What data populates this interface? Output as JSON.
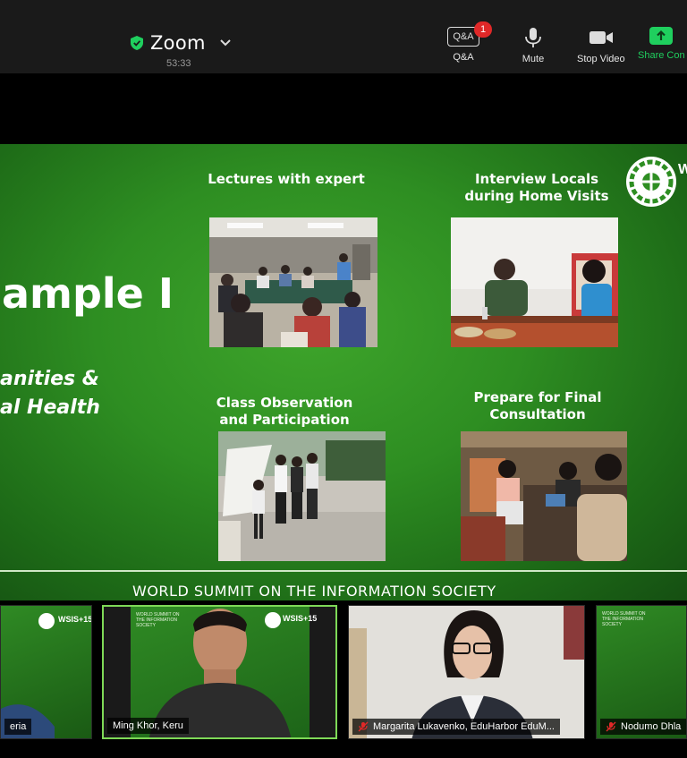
{
  "toolbar": {
    "app_name": "Zoom",
    "timer": "53:33",
    "qa_icon_text": "Q&A",
    "qa_badge": "1",
    "qa_label": "Q&A",
    "mute_label": "Mute",
    "stop_video_label": "Stop Video",
    "share_label": "Share Con"
  },
  "slide": {
    "title_fragment": "ample I",
    "sub_line1": "anities &",
    "sub_line2": "al Health",
    "captions": {
      "lectures": "Lectures with expert",
      "interview_1": "Interview Locals",
      "interview_2": "during Home Visits",
      "class_1": "Class Observation",
      "class_2": "and Participation",
      "prepare_1": "Prepare for Final",
      "prepare_2": "Consultation"
    },
    "logo_partial": "W",
    "footer": "WORLD SUMMIT ON THE INFORMATION SOCIETY"
  },
  "participants": [
    {
      "name": "eria"
    },
    {
      "name": "Ming Khor, Keru"
    },
    {
      "name": "Margarita Lukavenko, EduHarbor EduM..."
    },
    {
      "name": "Nodumo Dhla"
    }
  ],
  "tile_logo": {
    "text": "WSIS+15"
  },
  "colors": {
    "accent_green": "#1fcf5e",
    "active_border": "#7ed957",
    "badge_red": "#e02828",
    "slide_green": "#2e8e22"
  }
}
